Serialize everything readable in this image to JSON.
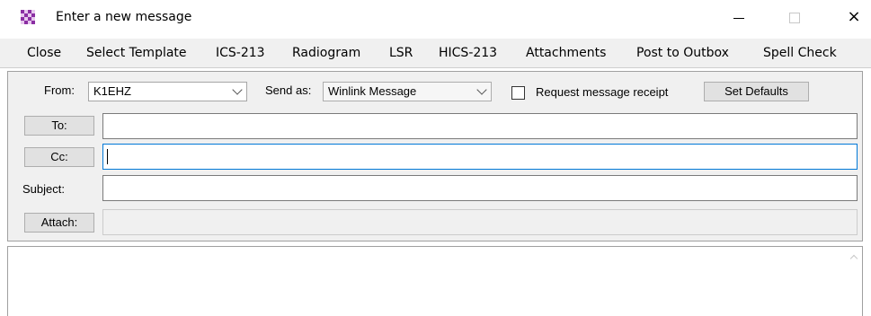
{
  "window": {
    "title": "Enter a new message",
    "minimize": "minimize",
    "maximize": "maximize",
    "close": "×"
  },
  "menu": {
    "items": [
      "Close",
      "Select Template",
      "ICS-213",
      "Radiogram",
      "LSR",
      "HICS-213",
      "Attachments",
      "Post to Outbox",
      "Spell Check"
    ]
  },
  "header": {
    "from_label": "From:",
    "from_value": "K1EHZ",
    "send_as_label": "Send as:",
    "send_as_value": "Winlink Message",
    "receipt_label": "Request message receipt",
    "receipt_checked": false,
    "set_defaults_label": "Set Defaults",
    "to_button": "To:",
    "to_value": "",
    "cc_button": "Cc:",
    "cc_value": "",
    "subject_label": "Subject:",
    "subject_value": "",
    "attach_button": "Attach:",
    "attach_value": ""
  },
  "body": {
    "text": ""
  },
  "colors": {
    "focus_border": "#0078d7",
    "icon_purple": "#8b2fa3"
  }
}
